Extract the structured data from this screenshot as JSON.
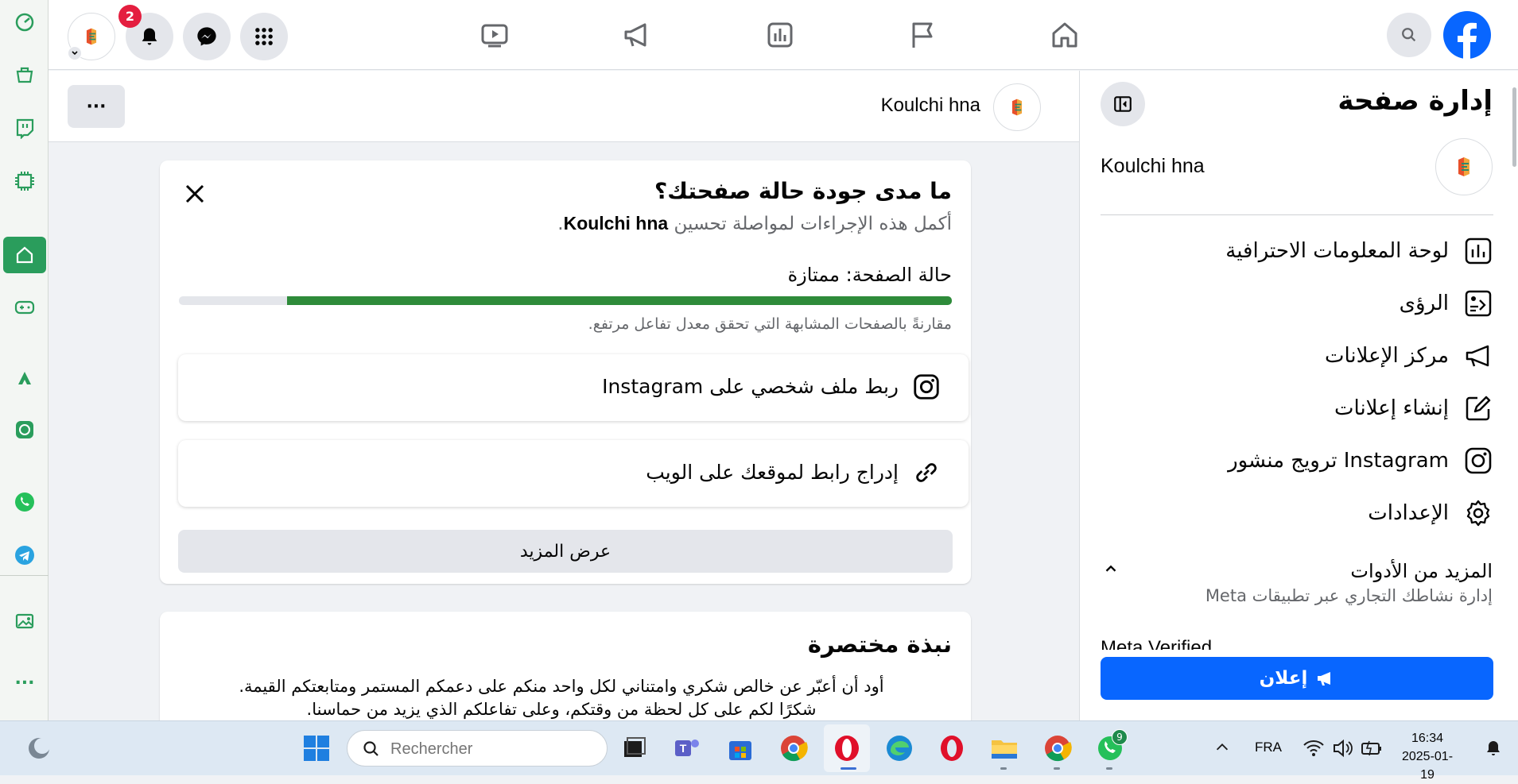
{
  "colors": {
    "fb_blue": "#0866ff",
    "progress_green": "#2e8b3a",
    "badge_red": "#e41e3f",
    "edge_accent": "#2a9d5c"
  },
  "edge_sidebar": {
    "icons": [
      "speed-icon",
      "shopping-icon",
      "twitch-icon",
      "chip-icon",
      "home-icon",
      "game-icon",
      "astro-icon",
      "chatgpt-icon",
      "whatsapp-icon",
      "telegram-icon",
      "image-icon",
      "more-icon"
    ],
    "more_label": "..."
  },
  "topbar": {
    "notification_count": "2",
    "nav_icons": [
      "video-icon",
      "megaphone-icon",
      "chart-icon",
      "flag-icon",
      "home-icon"
    ]
  },
  "page_header": {
    "page_name": "Koulchi hna",
    "more_label": "···"
  },
  "health_card": {
    "title": "ما مدى جودة حالة صفحتك؟",
    "subtitle_prefix": "أكمل هذه الإجراءات لمواصلة تحسين",
    "subtitle_page": "Koulchi hna",
    "subtitle_suffix": ".",
    "status_label": "حالة الصفحة: ممتازة",
    "progress": 0.86,
    "comparison": "مقارنةً بالصفحات المشابهة التي تحقق معدل تفاعل مرتفع.",
    "actions": [
      {
        "label": "ربط ملف شخصي على Instagram",
        "icon": "instagram-icon"
      },
      {
        "label": "إدراج رابط لموقعك على الويب",
        "icon": "link-icon"
      }
    ],
    "see_more": "عرض المزيد"
  },
  "about_card": {
    "title": "نبذة مختصرة",
    "line1": "أود أن أعبّر عن خالص شكري وامتناني لكل واحد منكم على دعمكم المستمر ومتابعتكم القيمة.",
    "line2": "شكرًا لكم على كل لحظة من وقتكم، وعلى تفاعلكم الذي يزيد من حماسنا."
  },
  "right_panel": {
    "title": "إدارة صفحة",
    "page_name": "Koulchi hna",
    "menu": [
      {
        "label": "لوحة المعلومات الاحترافية",
        "icon": "dashboard-icon"
      },
      {
        "label": "الرؤى",
        "icon": "insights-icon"
      },
      {
        "label": "مركز الإعلانات",
        "icon": "megaphone-icon"
      },
      {
        "label": "إنشاء إعلانات",
        "icon": "edit-icon"
      },
      {
        "label": "ترويج منشور Instagram",
        "icon": "instagram-icon"
      },
      {
        "label": "الإعدادات",
        "icon": "gear-icon"
      }
    ],
    "more_tools_title": "المزيد من الأدوات",
    "more_tools_sub": "إدارة نشاطك التجاري عبر تطبيقات Meta",
    "cut_item": "Meta Verified",
    "ad_button": "إعلان"
  },
  "taskbar": {
    "search_placeholder": "Rechercher",
    "language": "FRA",
    "time": "16:34",
    "date": "2025-01-19",
    "whatsapp_badge": "9"
  }
}
